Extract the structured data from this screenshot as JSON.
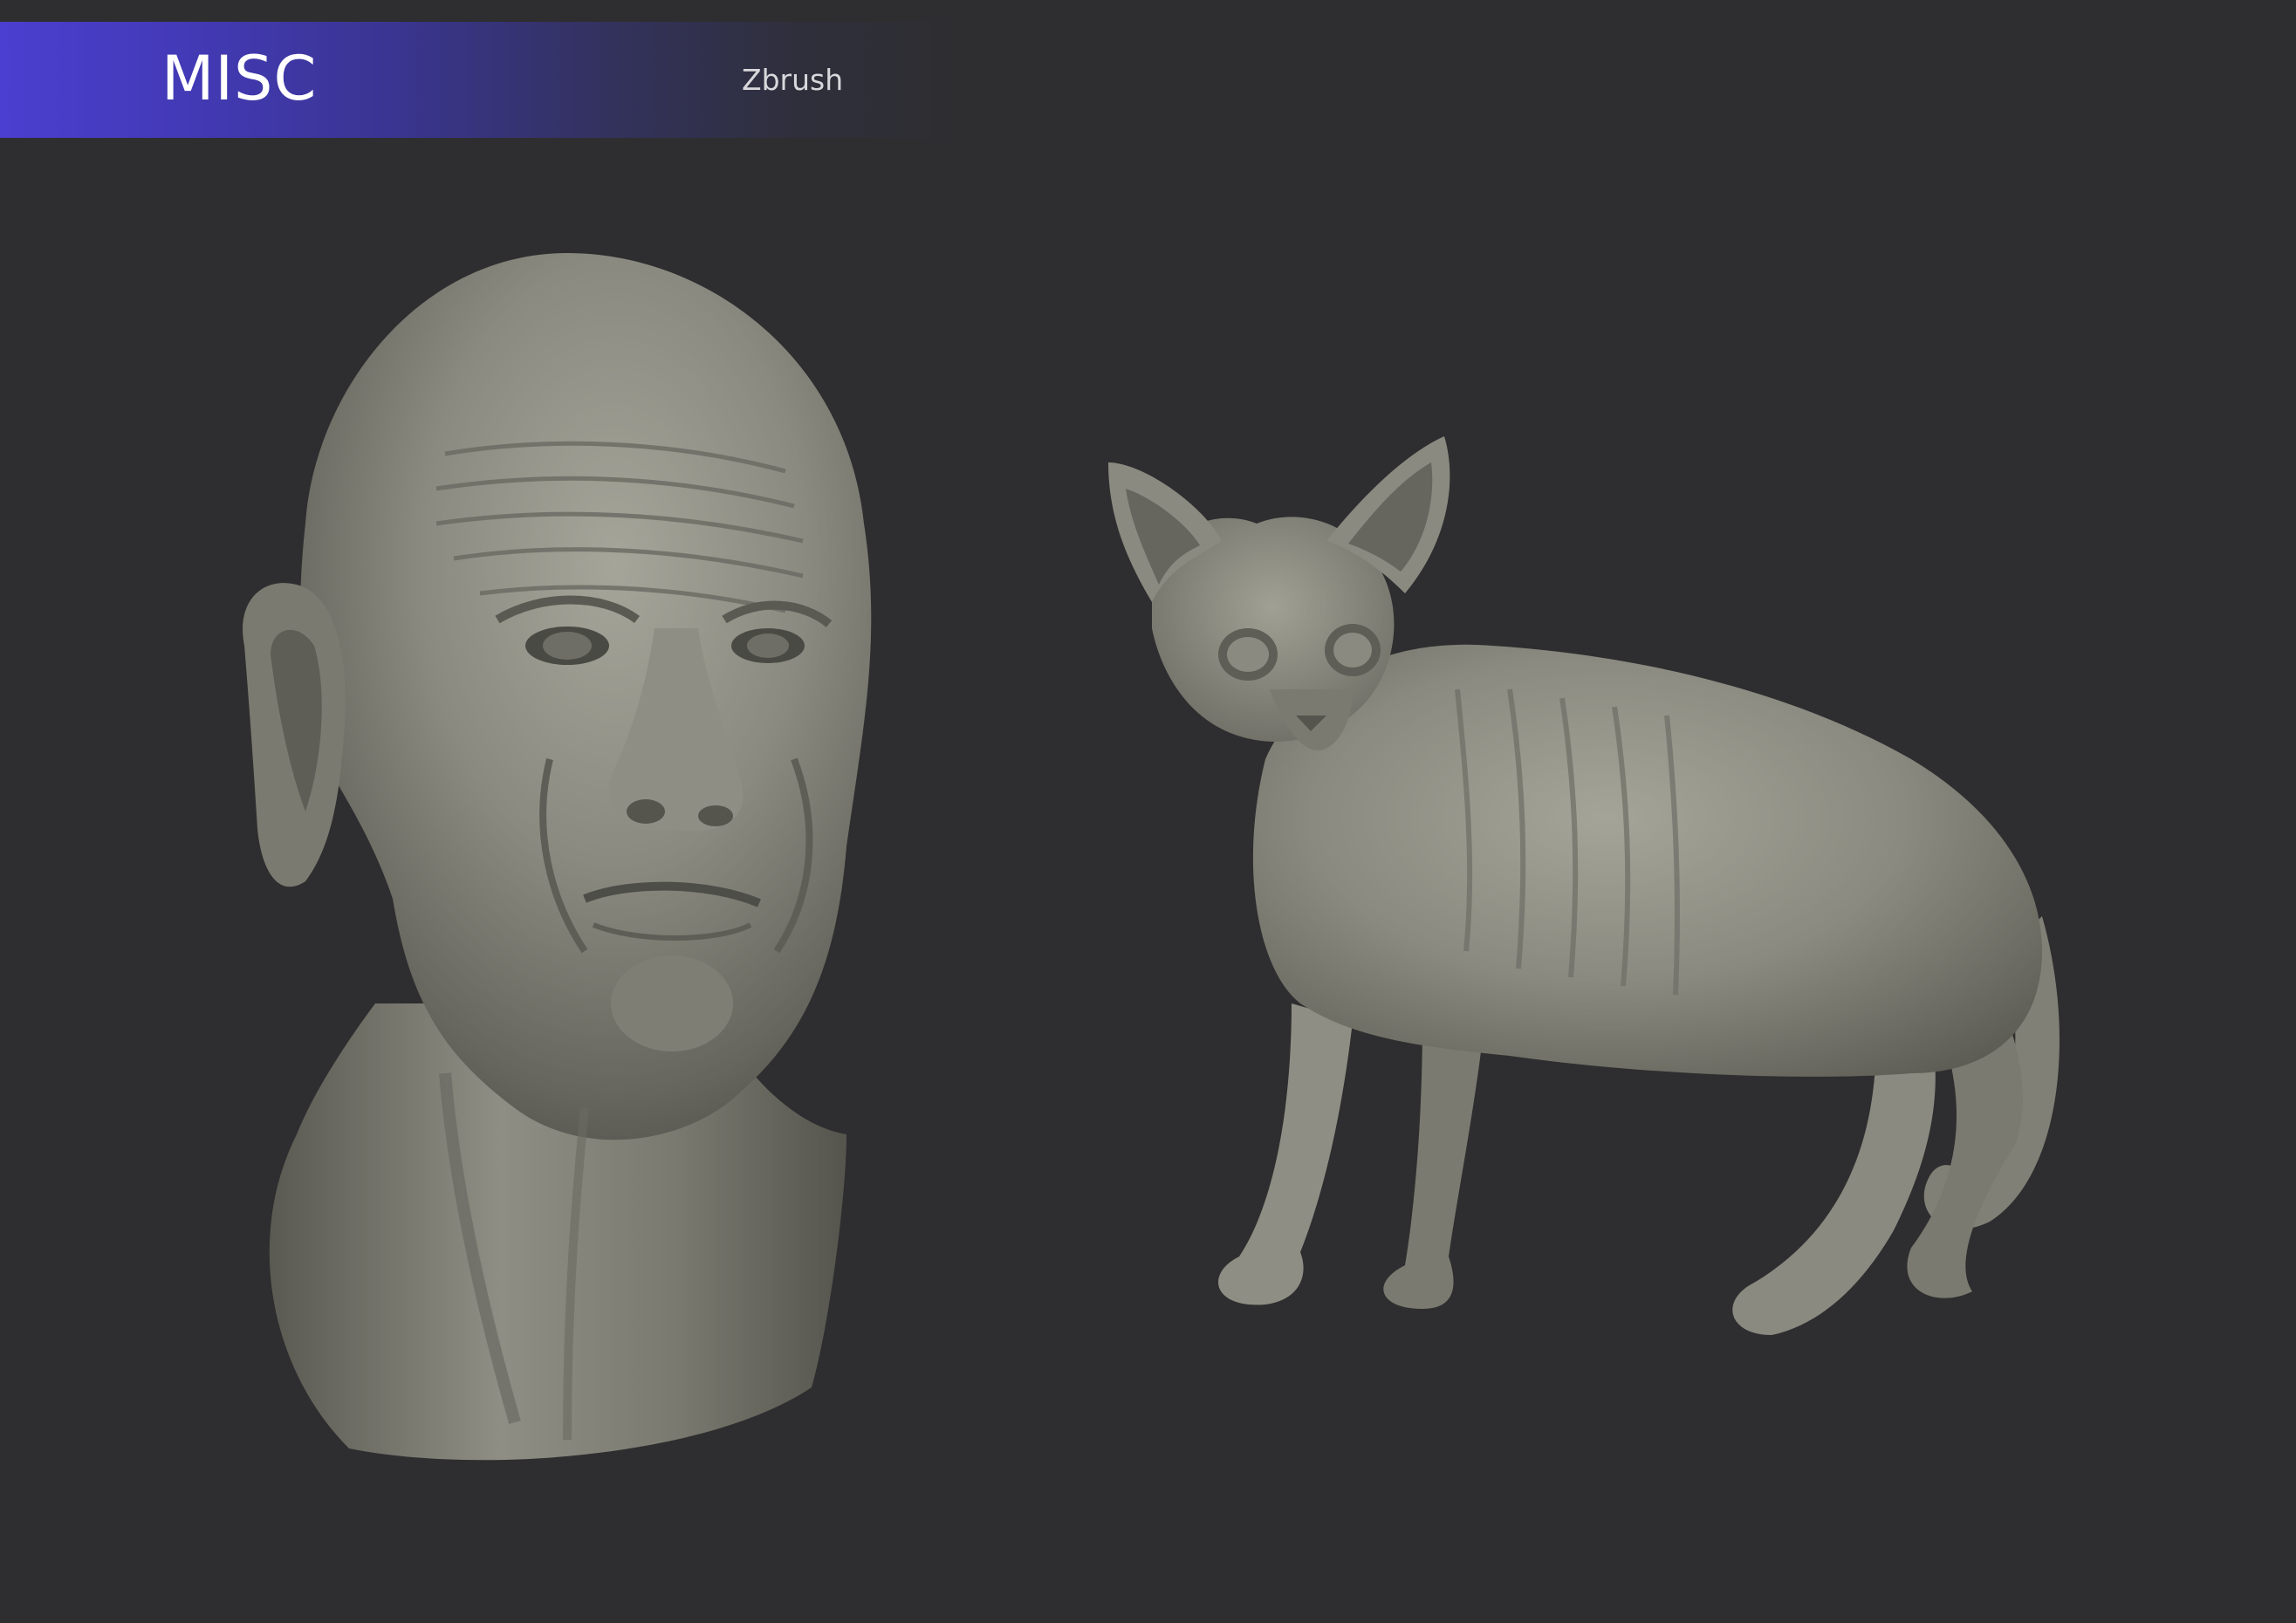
{
  "header": {
    "title": "MISC",
    "subtitle": "Zbrush"
  },
  "gallery": {
    "items": [
      {
        "subject": "old-man-head-sculpt-image"
      },
      {
        "subject": "sphynx-cat-sculpt-image"
      }
    ]
  },
  "colors": {
    "background": "#2e2e30",
    "banner_accent": "#4a3fd0",
    "sculpt_clay": "#8a8a80"
  }
}
